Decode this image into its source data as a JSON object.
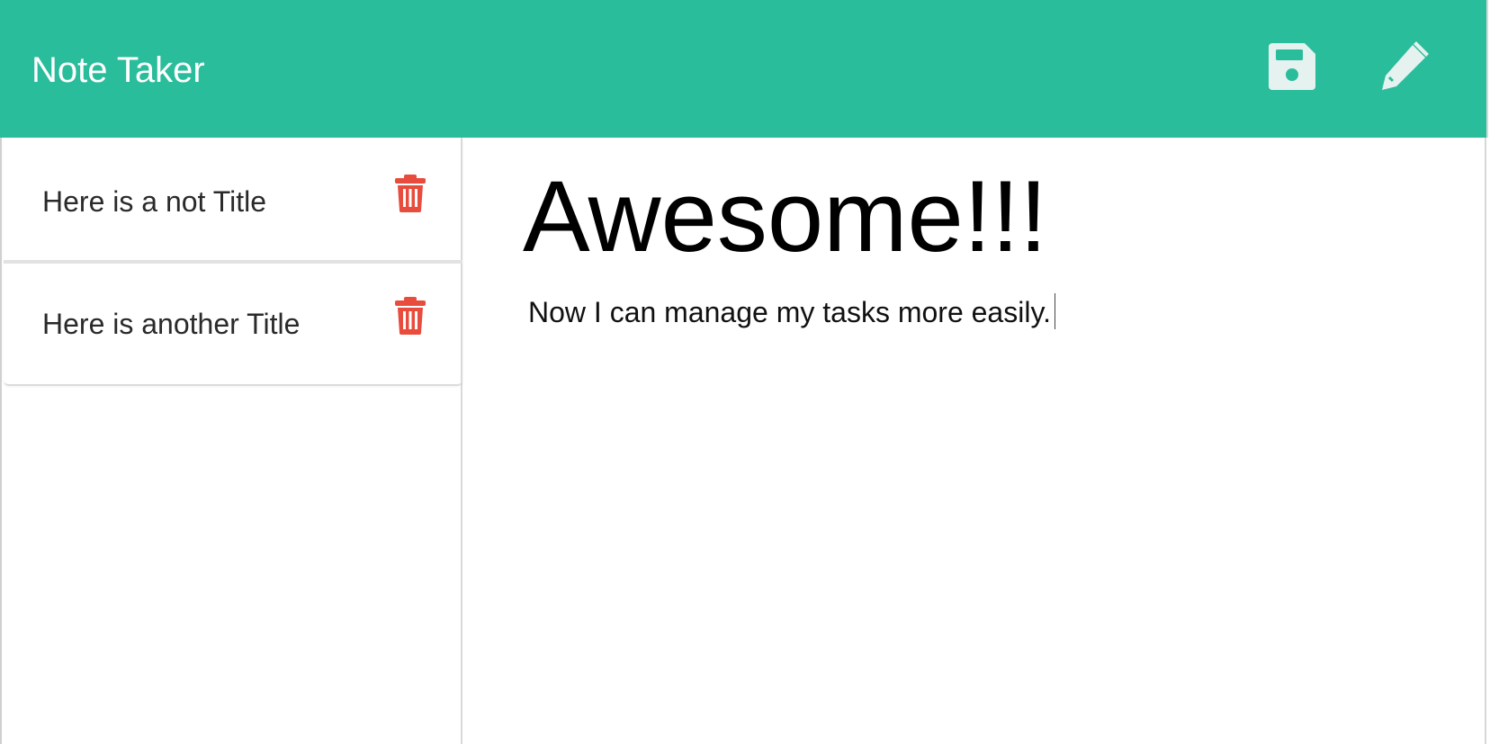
{
  "header": {
    "title": "Note Taker",
    "icons": {
      "save": "save-icon",
      "edit": "pencil-icon"
    },
    "color": "#2abd9b"
  },
  "notes": [
    {
      "title": "Here is a not Title",
      "delete_icon": "trash-icon"
    },
    {
      "title": "Here is another Title",
      "delete_icon": "trash-icon"
    }
  ],
  "editor": {
    "title": "Awesome!!!",
    "body": "Now I can manage my tasks more easily."
  },
  "colors": {
    "accent": "#2abd9b",
    "delete": "#e74c3c",
    "icon": "#e6f2ef"
  }
}
